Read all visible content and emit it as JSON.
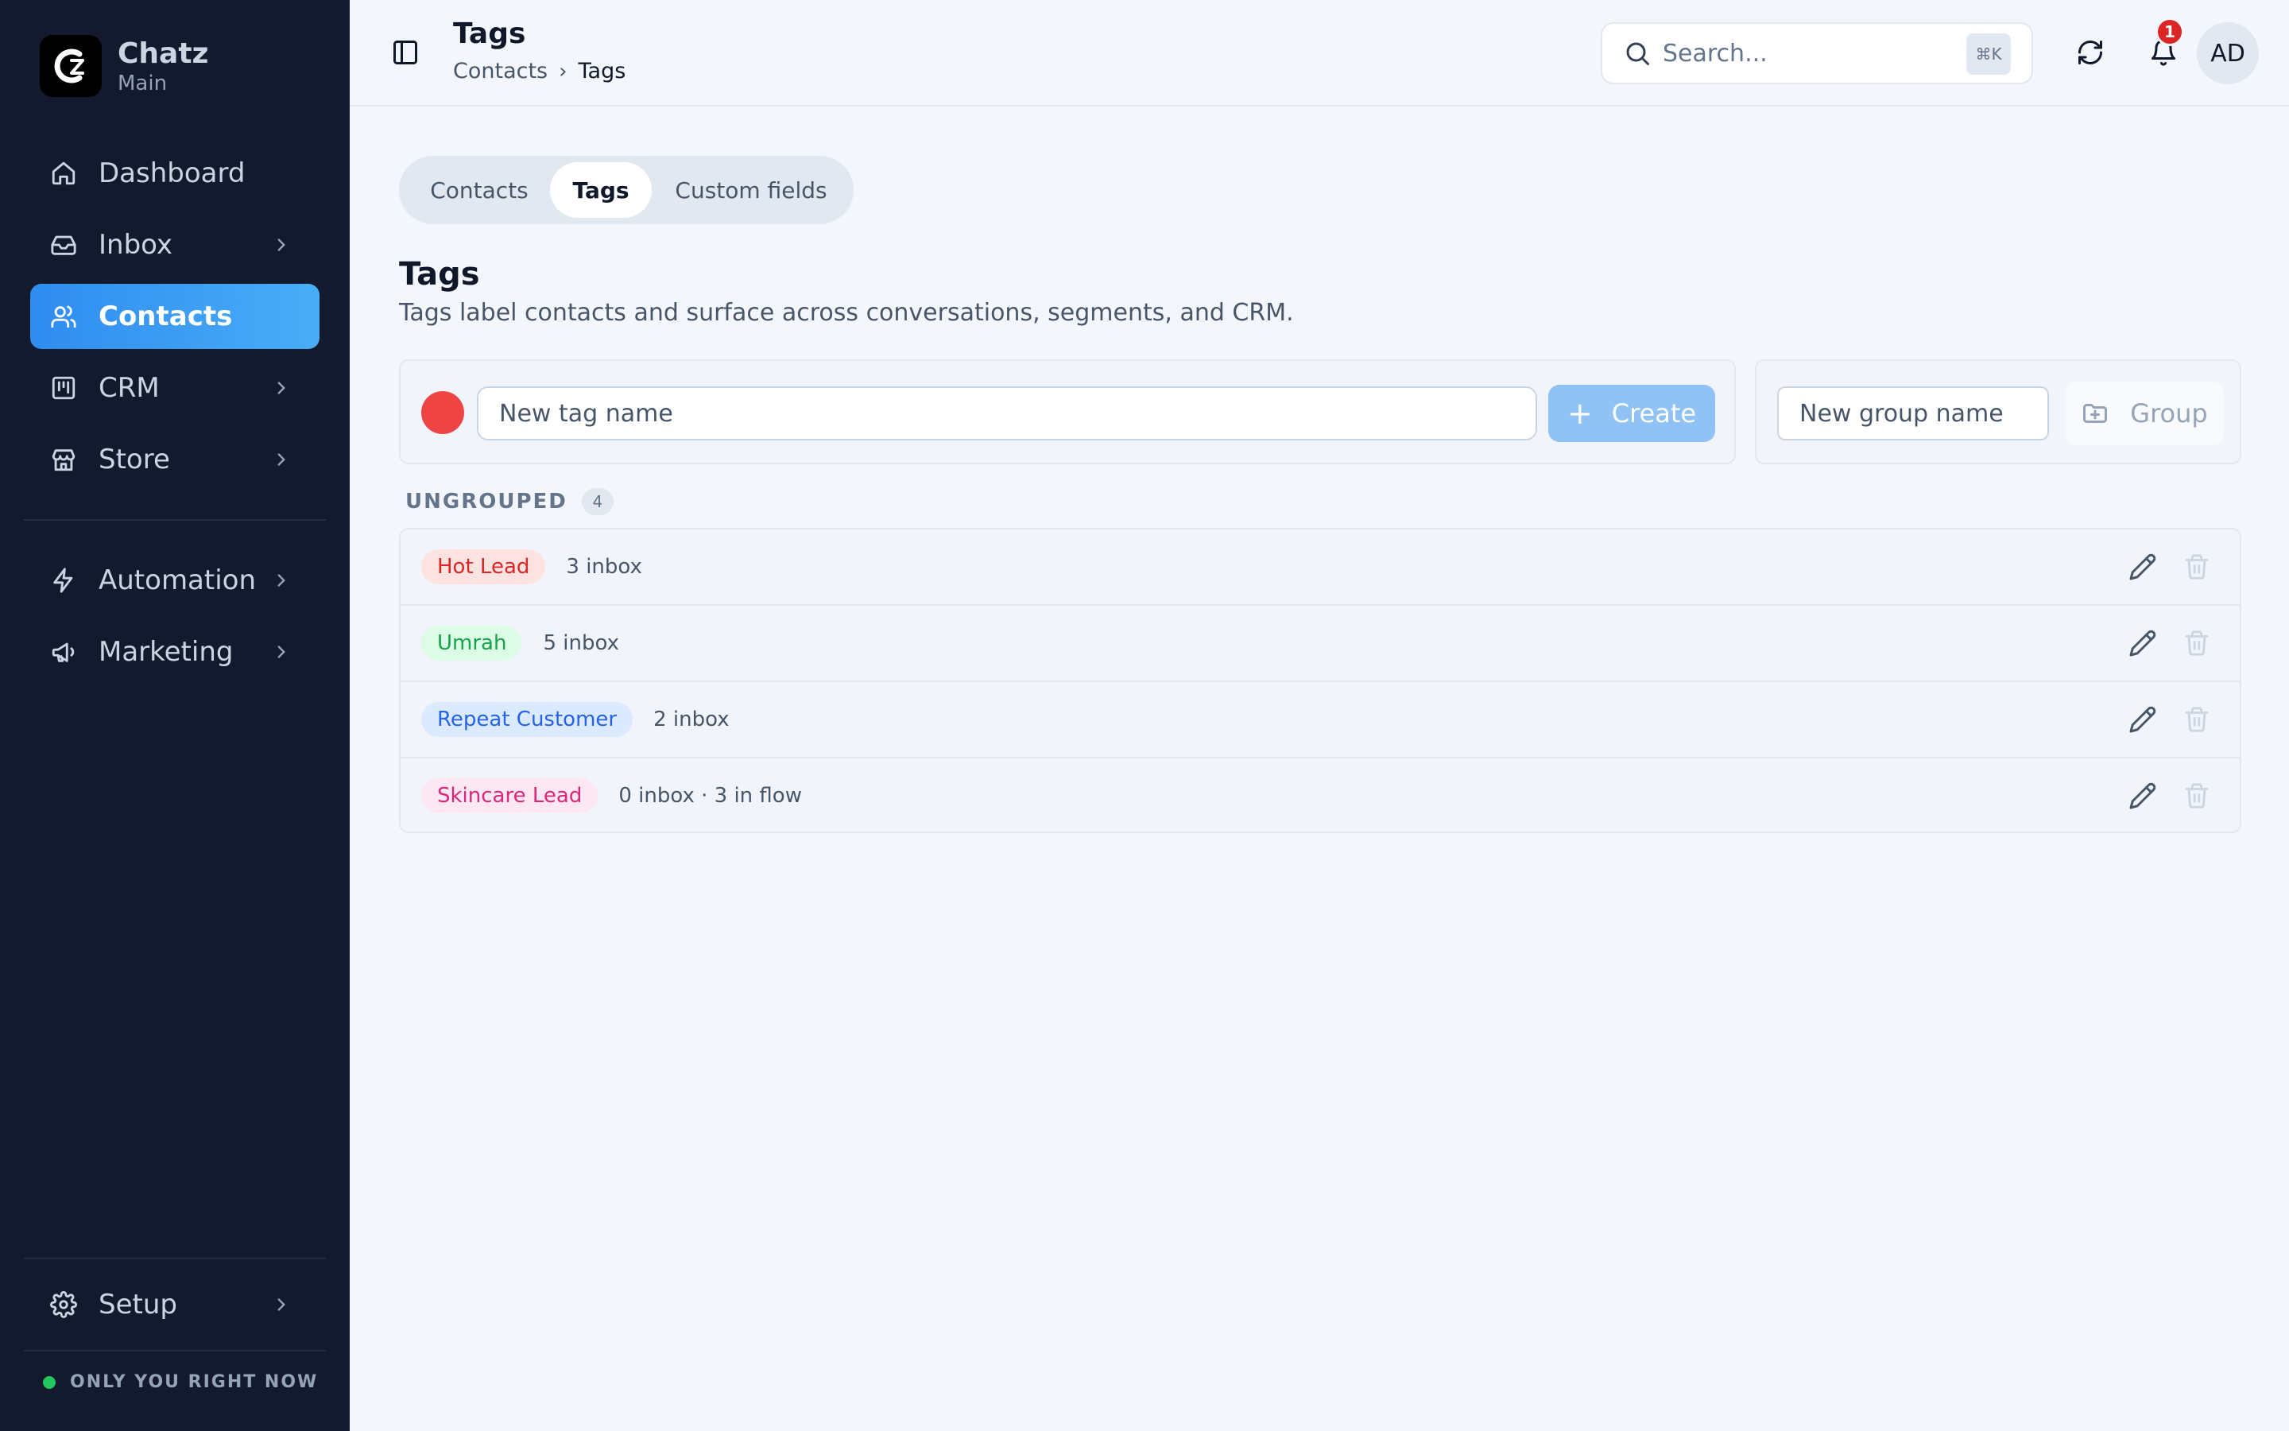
{
  "brand": {
    "name": "Chatz",
    "workspace": "Main",
    "logo_icon": "chatz-logo-icon"
  },
  "sidebar": {
    "items": [
      {
        "label": "Dashboard",
        "icon": "home-icon",
        "has_children": false,
        "active": false
      },
      {
        "label": "Inbox",
        "icon": "inbox-icon",
        "has_children": true,
        "active": false
      },
      {
        "label": "Contacts",
        "icon": "users-icon",
        "has_children": false,
        "active": true
      },
      {
        "label": "CRM",
        "icon": "kanban-icon",
        "has_children": true,
        "active": false
      },
      {
        "label": "Store",
        "icon": "store-icon",
        "has_children": true,
        "active": false
      },
      {
        "label": "Automation",
        "icon": "lightning-icon",
        "has_children": true,
        "active": false
      },
      {
        "label": "Marketing",
        "icon": "megaphone-icon",
        "has_children": true,
        "active": false
      }
    ],
    "setup": {
      "label": "Setup",
      "icon": "gear-icon"
    },
    "status_text": "ONLY YOU RIGHT NOW",
    "status_color": "#22c55e"
  },
  "header": {
    "title": "Tags",
    "breadcrumb": {
      "parent": "Contacts",
      "current": "Tags"
    },
    "search": {
      "placeholder": "Search...",
      "shortcut": "⌘K"
    },
    "notification_count": "1",
    "avatar_initials": "AD"
  },
  "tabs": [
    {
      "label": "Contacts",
      "active": false
    },
    {
      "label": "Tags",
      "active": true
    },
    {
      "label": "Custom fields",
      "active": false
    }
  ],
  "section": {
    "title": "Tags",
    "description": "Tags label contacts and surface across conversations, segments, and CRM."
  },
  "create_tag": {
    "color": "#ef4444",
    "placeholder": "New tag name",
    "button_label": "Create"
  },
  "create_group": {
    "placeholder": "New group name",
    "button_label": "Group"
  },
  "ungrouped": {
    "label": "UNGROUPED",
    "count": "4",
    "tags": [
      {
        "name": "Hot Lead",
        "meta": "3 inbox",
        "bg": "#fde2e2",
        "fg": "#dc2626"
      },
      {
        "name": "Umrah",
        "meta": "5 inbox",
        "bg": "#dcfce7",
        "fg": "#16a34a"
      },
      {
        "name": "Repeat Customer",
        "meta": "2 inbox",
        "bg": "#dbeafe",
        "fg": "#2563eb"
      },
      {
        "name": "Skincare Lead",
        "meta": "0 inbox · 3 in flow",
        "bg": "#fce7f3",
        "fg": "#db2777"
      }
    ]
  },
  "colors": {
    "accent": "#2f8cf0",
    "sidebar_bg": "#141a2e",
    "page_bg": "#f3f6fb"
  }
}
